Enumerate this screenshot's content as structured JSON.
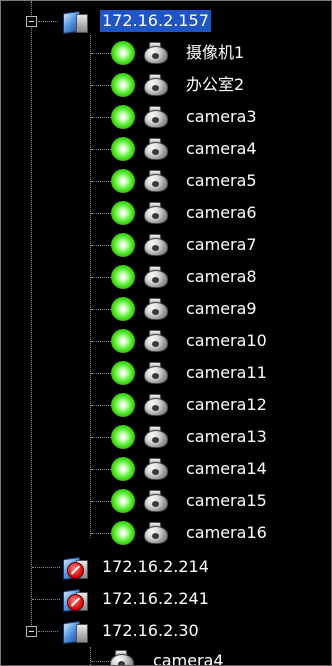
{
  "tree": {
    "servers": [
      {
        "label": "172.16.2.157",
        "expanded": true,
        "selected": true,
        "status": "connected",
        "cameras": [
          {
            "label": "摄像机1"
          },
          {
            "label": "办公室2"
          },
          {
            "label": "camera3"
          },
          {
            "label": "camera4"
          },
          {
            "label": "camera5"
          },
          {
            "label": "camera6"
          },
          {
            "label": "camera7"
          },
          {
            "label": "camera8"
          },
          {
            "label": "camera9"
          },
          {
            "label": "camera10"
          },
          {
            "label": "camera11"
          },
          {
            "label": "camera12"
          },
          {
            "label": "camera13"
          },
          {
            "label": "camera14"
          },
          {
            "label": "camera15"
          },
          {
            "label": "camera16"
          }
        ]
      },
      {
        "label": "172.16.2.214",
        "expanded": false,
        "selected": false,
        "status": "disconnected"
      },
      {
        "label": "172.16.2.241",
        "expanded": false,
        "selected": false,
        "status": "disconnected"
      },
      {
        "label": "172.16.2.30",
        "expanded": true,
        "selected": false,
        "status": "connected",
        "cameras": [
          {
            "label": "camera4"
          }
        ]
      }
    ]
  },
  "colors": {
    "background": "#000000",
    "text": "#ffffff",
    "selection": "#1f55c4",
    "online": "#3fe01a",
    "offline": "#d60000"
  },
  "icons": {
    "toggle_collapse": "minus-box-icon",
    "server_online": "server-icon",
    "server_offline": "server-blocked-icon",
    "camera_status": "online-status-icon",
    "camera": "dome-camera-icon"
  }
}
